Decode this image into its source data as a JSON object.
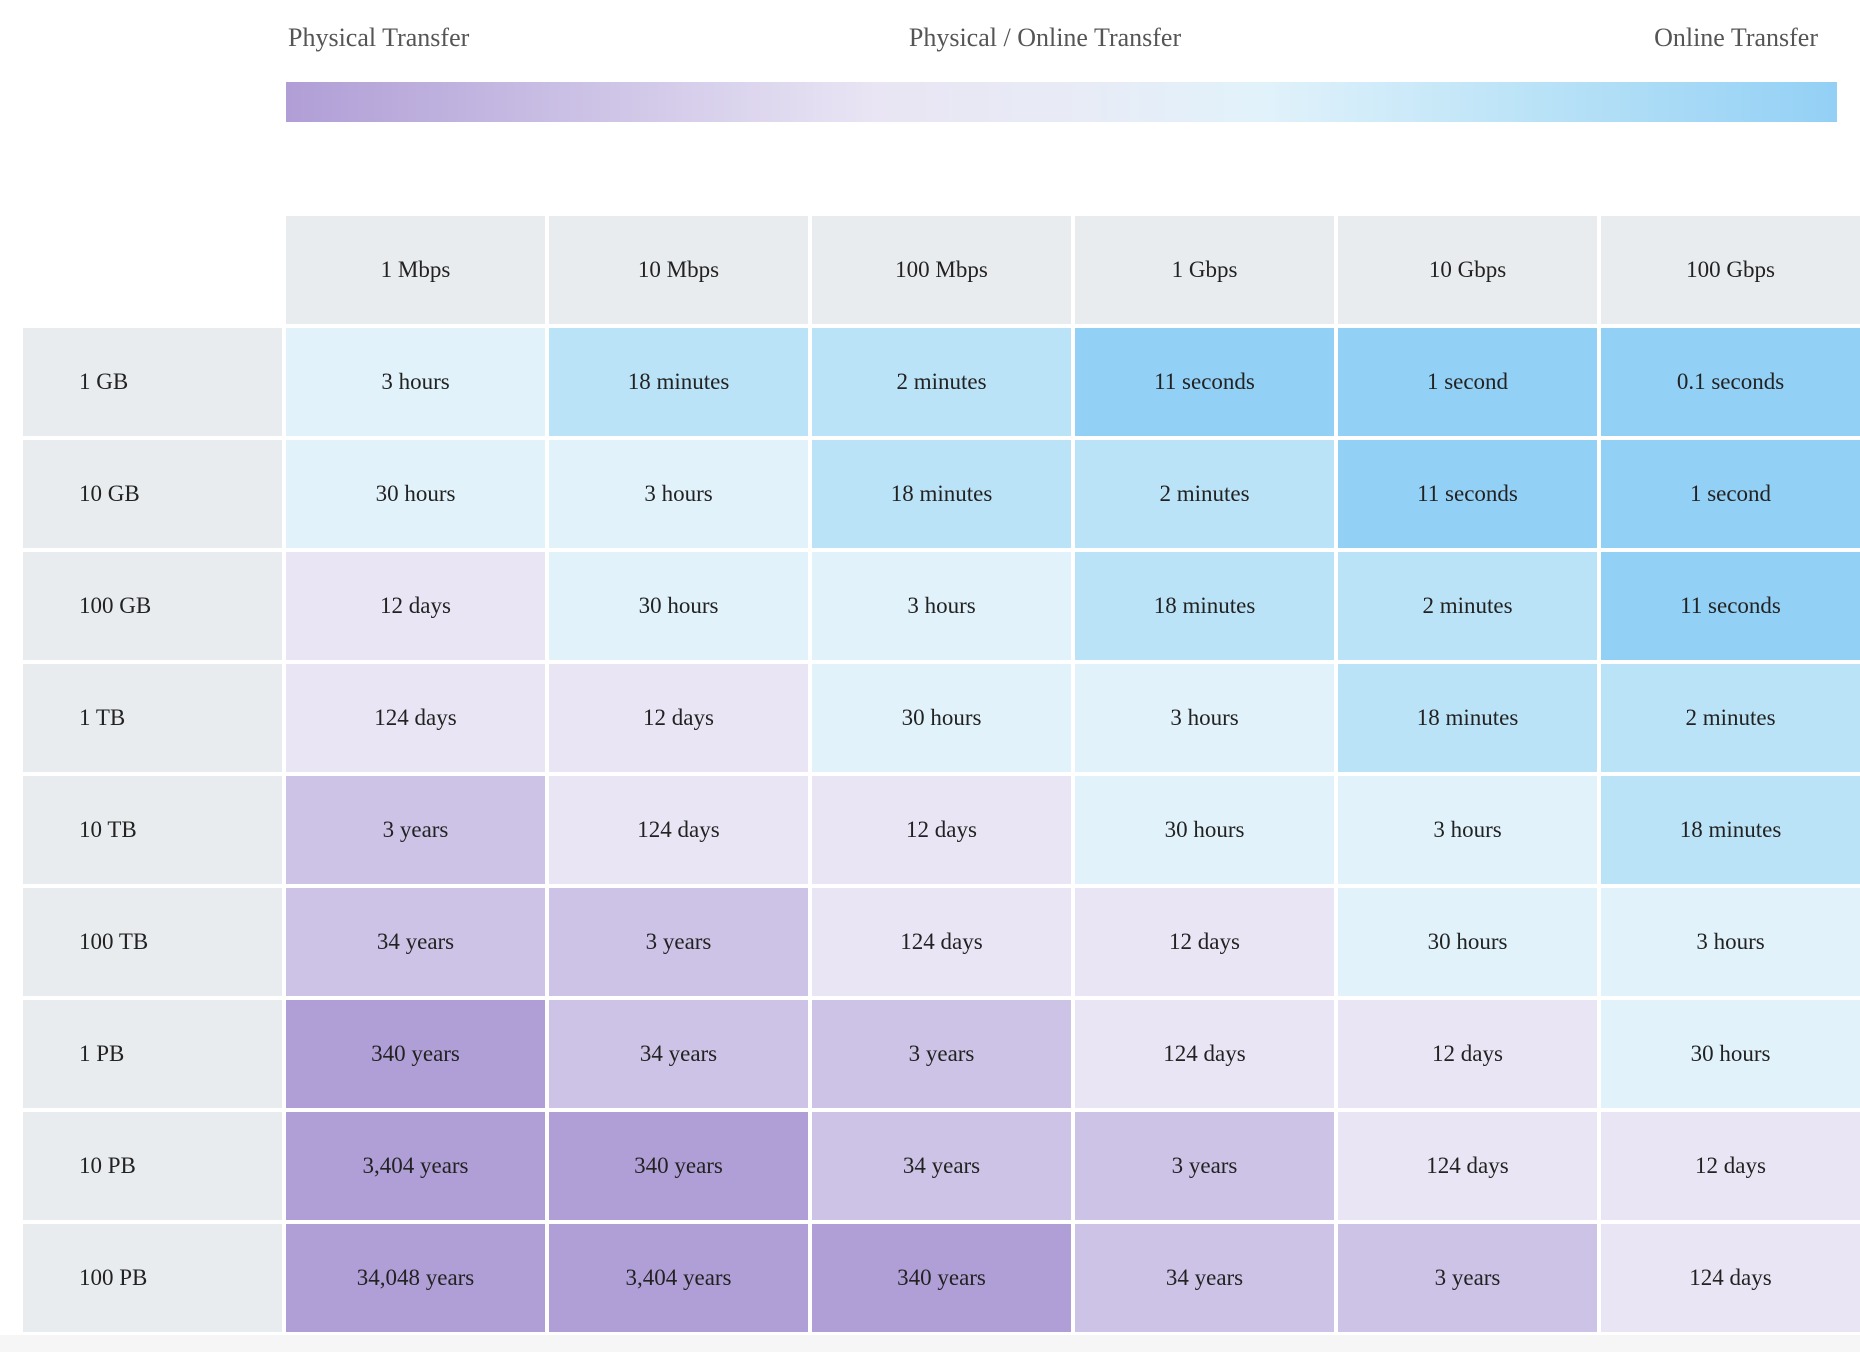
{
  "legend": {
    "left": "Physical Transfer",
    "middle": "Physical / Online Transfer",
    "right": "Online Transfer",
    "gradient_colors": [
      "#b09ed6",
      "#cdc3e6",
      "#e9e5f4",
      "#e1f2fb",
      "#bbe3f7",
      "#93d0f5"
    ]
  },
  "columns": [
    "1 Mbps",
    "10 Mbps",
    "100 Mbps",
    "1 Gbps",
    "10 Gbps",
    "100 Gbps"
  ],
  "rows": [
    {
      "label": "1 GB",
      "cells": [
        "3 hours",
        "18 minutes",
        "2 minutes",
        "11 seconds",
        "1 second",
        "0.1 seconds"
      ]
    },
    {
      "label": "10 GB",
      "cells": [
        "30 hours",
        "3 hours",
        "18 minutes",
        "2 minutes",
        "11 seconds",
        "1 second"
      ]
    },
    {
      "label": "100 GB",
      "cells": [
        "12 days",
        "30 hours",
        "3 hours",
        "18 minutes",
        "2 minutes",
        "11 seconds"
      ]
    },
    {
      "label": "1 TB",
      "cells": [
        "124 days",
        "12 days",
        "30 hours",
        "3 hours",
        "18 minutes",
        "2 minutes"
      ]
    },
    {
      "label": "10 TB",
      "cells": [
        "3 years",
        "124 days",
        "12 days",
        "30 hours",
        "3 hours",
        "18 minutes"
      ]
    },
    {
      "label": "100 TB",
      "cells": [
        "34 years",
        "3 years",
        "124 days",
        "12 days",
        "30 hours",
        "3 hours"
      ]
    },
    {
      "label": "1 PB",
      "cells": [
        "340 years",
        "34 years",
        "3 years",
        "124 days",
        "12 days",
        "30 hours"
      ]
    },
    {
      "label": "10 PB",
      "cells": [
        "3,404 years",
        "340 years",
        "34 years",
        "3 years",
        "124 days",
        "12 days"
      ]
    },
    {
      "label": "100 PB",
      "cells": [
        "34,048 years",
        "3,404 years",
        "340 years",
        "34 years",
        "3 years",
        "124 days"
      ]
    }
  ]
}
